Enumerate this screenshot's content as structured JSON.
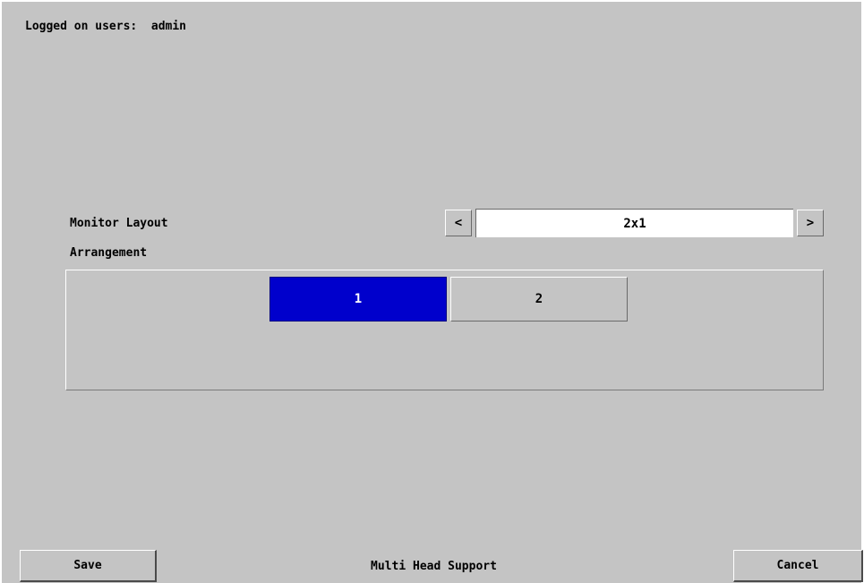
{
  "header": {
    "logged_on_text": "Logged on users:  admin"
  },
  "monitor_layout": {
    "label": "Monitor Layout",
    "value": "2x1",
    "prev_glyph": "<",
    "next_glyph": ">"
  },
  "arrangement": {
    "label": "Arrangement",
    "monitors": [
      {
        "label": "1",
        "selected": true
      },
      {
        "label": "2",
        "selected": false
      }
    ]
  },
  "footer": {
    "save_label": "Save",
    "title": "Multi Head Support",
    "cancel_label": "Cancel"
  },
  "colors": {
    "background": "#c4c4c4",
    "selected": "#0000cc",
    "selected_text": "#ffffff",
    "field": "#ffffff"
  }
}
